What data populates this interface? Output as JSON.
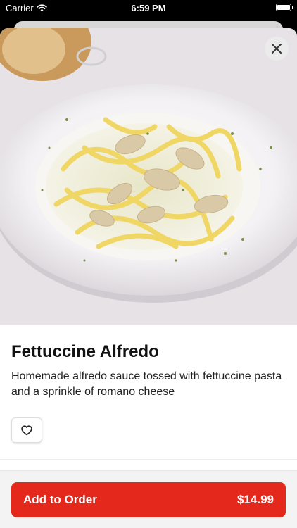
{
  "status_bar": {
    "carrier": "Carrier",
    "time": "6:59 PM"
  },
  "item": {
    "title": "Fettuccine Alfredo",
    "description": "Homemade alfredo sauce tossed with fettuccine pasta and a sprinkle of romano cheese"
  },
  "footer": {
    "add_label": "Add to Order",
    "price": "$14.99"
  },
  "colors": {
    "accent": "#e4291c",
    "status_bar": "#000000",
    "background": "#ffffff"
  },
  "icons": {
    "close": "close-icon",
    "favorite": "heart-icon",
    "wifi": "wifi-icon",
    "battery": "battery-icon"
  }
}
